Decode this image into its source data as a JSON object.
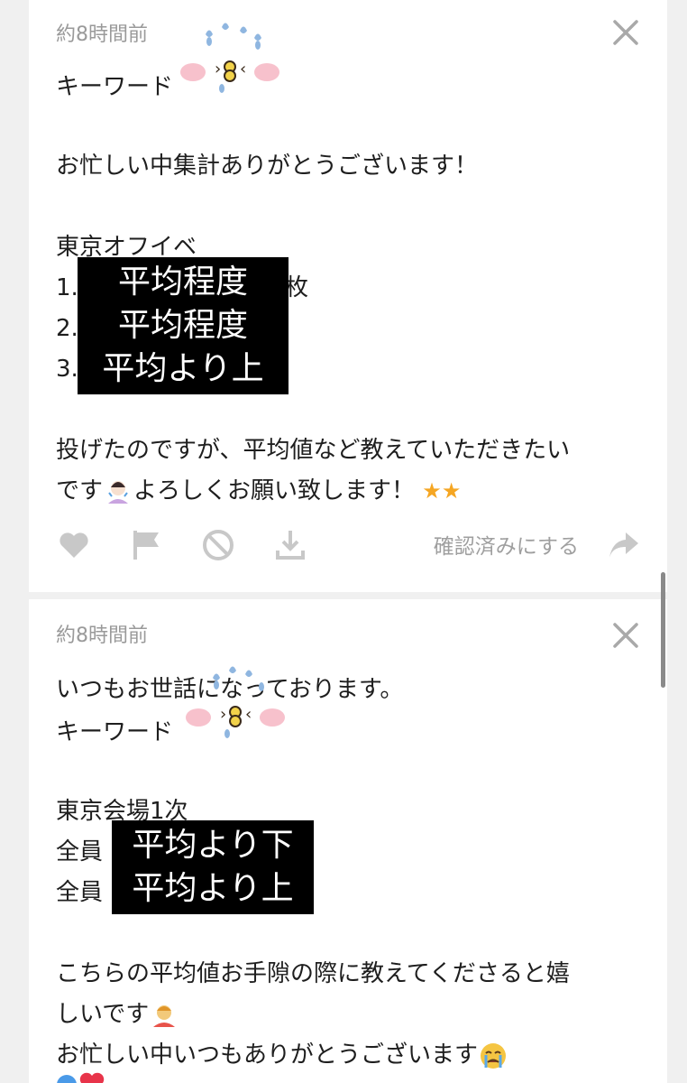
{
  "card1": {
    "timestamp": "約8時間前",
    "lines": {
      "keyword": "キーワード",
      "thanks": "お忙しい中集計ありがとうございます！",
      "heading": "東京オフイベ",
      "item1_num": "1.",
      "item1_tail": "枚",
      "item2_num": "2.",
      "item3_num": "3.",
      "note1": "投げたのですが、平均値など教えていただきたい",
      "note2": "です",
      "note2_tail": "よろしくお願い致します！"
    },
    "redaction": [
      "平均程度",
      "平均程度",
      "平均より上"
    ],
    "confirm_label": "確認済みにする"
  },
  "card2": {
    "timestamp": "約8時間前",
    "lines": {
      "greeting": "いつもお世話になっております。",
      "keyword": "キーワード",
      "heading": "東京会場1次",
      "row1": "全員",
      "row2": "全員"
    },
    "redaction": [
      "平均より下",
      "平均より上"
    ],
    "body2": {
      "l1": "こちらの平均値お手隙の際に教えてくださると嬉",
      "l2": "しいです",
      "l3": "お忙しい中いつもありがとうございます"
    }
  },
  "icons": {
    "like": "heart-icon",
    "flag": "flag-icon",
    "block": "block-icon",
    "download": "download-icon",
    "share": "share-icon",
    "close": "close-icon"
  },
  "colors": {
    "background": "#f0f0f0",
    "card": "#ffffff",
    "muted": "#9a9a9a",
    "icon": "#c4c4c4",
    "star": "#f5a623"
  }
}
